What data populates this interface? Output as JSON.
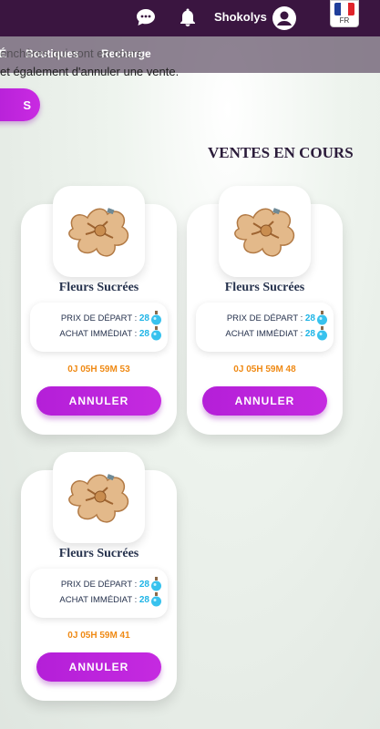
{
  "topbar": {
    "username": "Shokolys",
    "language": "FR",
    "flag_colors": [
      "#1f3f9b",
      "#ffffff",
      "#e0242b"
    ]
  },
  "nav": {
    "partial_item": "É",
    "items": [
      "Boutiques",
      "Recharge"
    ]
  },
  "overlay": {
    "line1": "enchères qui sont en cours.",
    "line2": "et également d'annuler une vente."
  },
  "pill_button": {
    "label": "S"
  },
  "section_title": "VENTES EN COURS",
  "labels": {
    "start_price": "PRIX DE DÉPART :",
    "buy_now": "ACHAT IMMÉDIAT :",
    "cancel": "ANNULER"
  },
  "colors": {
    "accent": "#c027dd",
    "timer": "#ef8a15",
    "price": "#1fb4e6",
    "topbar": "#3a1540"
  },
  "sales": [
    {
      "name": "Fleurs Sucrées",
      "start_price": "28",
      "buy_now": "28",
      "timer": "0J 05H 59M 53"
    },
    {
      "name": "Fleurs Sucrées",
      "start_price": "28",
      "buy_now": "28",
      "timer": "0J 05H 59M 48"
    },
    {
      "name": "Fleurs Sucrées",
      "start_price": "28",
      "buy_now": "28",
      "timer": "0J 05H 59M 41"
    }
  ]
}
